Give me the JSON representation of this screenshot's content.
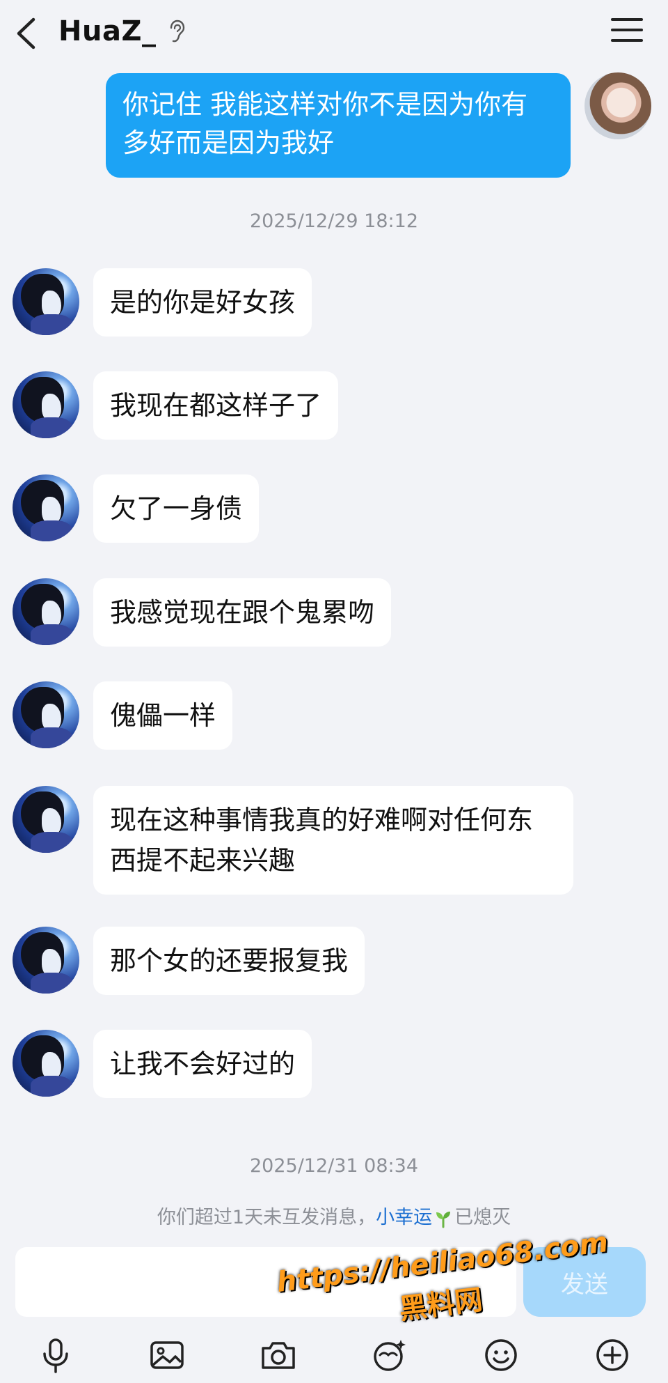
{
  "header": {
    "title": "HuaZ_"
  },
  "messages_out": [
    {
      "text": "你记住 我能这样对你不是因为你有多好而是因为我好"
    }
  ],
  "timestamps": [
    "2025/12/29 18:12",
    "2025/12/31 08:34"
  ],
  "messages_in": [
    {
      "text": "是的你是好女孩"
    },
    {
      "text": "我现在都这样子了"
    },
    {
      "text": "欠了一身债"
    },
    {
      "text": "我感觉现在跟个鬼累吻"
    },
    {
      "text": "傀儡一样"
    },
    {
      "text": "现在这种事情我真的好难啊对任何东西提不起来兴趣"
    },
    {
      "text": "那个女的还要报复我"
    },
    {
      "text": "让我不会好过的"
    }
  ],
  "system_note": {
    "prefix": "你们超过1天未互发消息，",
    "link": "小幸运",
    "suffix": "已熄灭"
  },
  "input": {
    "send_label": "发送"
  },
  "watermark": {
    "url": "https://heiliao68.com",
    "name": "黑料网"
  },
  "toolbar": {
    "icons": [
      "microphone-icon",
      "image-icon",
      "camera-icon",
      "sticker-icon",
      "emoji-icon",
      "plus-icon"
    ]
  },
  "colors": {
    "outgoing_bubble": "#1ca3f5",
    "send_button": "#a6d8fb",
    "link": "#1c6fd1",
    "watermark": "#ff9c1a"
  }
}
